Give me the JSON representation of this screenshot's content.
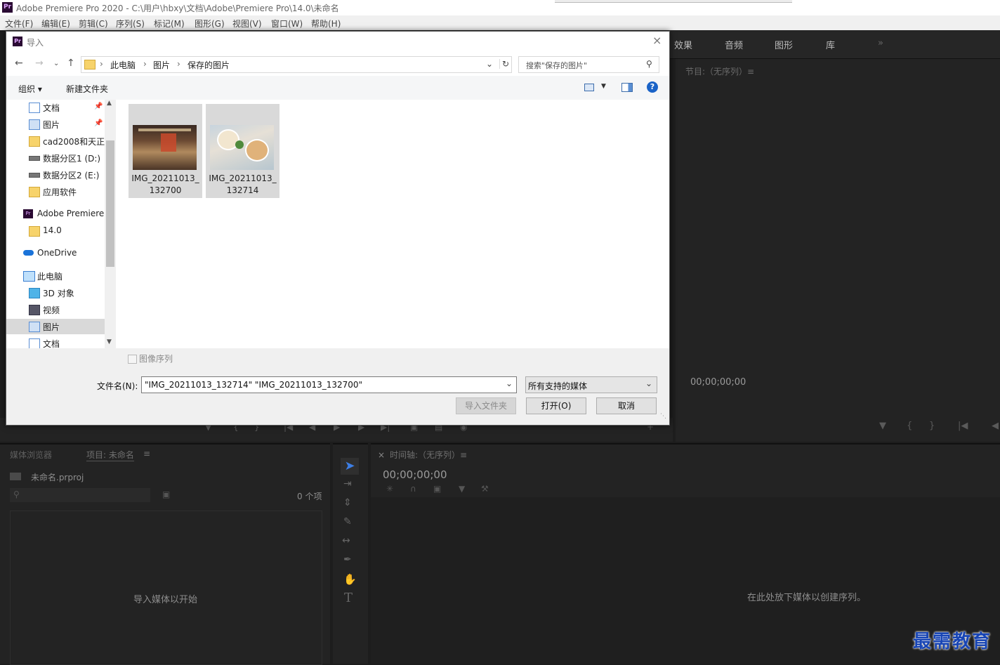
{
  "app": {
    "logo": "Pr",
    "title": "Adobe Premiere Pro 2020 - C:\\用户\\hbxy\\文档\\Adobe\\Premiere Pro\\14.0\\未命名"
  },
  "menu": [
    "文件(F)",
    "编辑(E)",
    "剪辑(C)",
    "序列(S)",
    "标记(M)",
    "图形(G)",
    "视图(V)",
    "窗口(W)",
    "帮助(H)"
  ],
  "workspace_tabs": [
    "效果",
    "音频",
    "图形",
    "库",
    "»"
  ],
  "program_monitor": {
    "title": "节目:（无序列）≡",
    "timecode": "00;00;00;00"
  },
  "project_panel": {
    "tab_media_browser": "媒体浏览器",
    "tab_project": "项目: 未命名",
    "menu_glyph": "≡",
    "project_file": "未命名.prproj",
    "item_count": "0 个项",
    "empty_hint": "导入媒体以开始"
  },
  "timeline": {
    "close": "×",
    "title": "时间轴:（无序列）≡",
    "timecode": "00;00;00;00",
    "empty_hint": "在此处放下媒体以创建序列。"
  },
  "dialog": {
    "title": "导入",
    "close": "×",
    "breadcrumb": [
      "此电脑",
      "图片",
      "保存的图片"
    ],
    "search_placeholder": "搜索\"保存的图片\"",
    "organize": "组织 ▾",
    "new_folder": "新建文件夹",
    "help": "?",
    "nav_items": [
      {
        "label": "文档",
        "icon": "document-icon",
        "pinned": true
      },
      {
        "label": "图片",
        "icon": "pictures-icon",
        "pinned": true
      },
      {
        "label": "cad2008和天正",
        "icon": "folder-icon"
      },
      {
        "label": "数据分区1 (D:)",
        "icon": "drive-icon"
      },
      {
        "label": "数据分区2 (E:)",
        "icon": "drive-icon"
      },
      {
        "label": "应用软件",
        "icon": "folder-icon"
      },
      {
        "label": "Adobe Premiere",
        "icon": "premiere-icon"
      },
      {
        "label": "14.0",
        "icon": "folder-icon"
      },
      {
        "label": "OneDrive",
        "icon": "onedrive-icon"
      },
      {
        "label": "此电脑",
        "icon": "computer-icon"
      },
      {
        "label": "3D 对象",
        "icon": "3d-objects-icon"
      },
      {
        "label": "视频",
        "icon": "video-icon"
      },
      {
        "label": "图片",
        "icon": "pictures-icon",
        "selected": true
      },
      {
        "label": "文档",
        "icon": "document-icon"
      }
    ],
    "files": [
      {
        "line1": "IMG_20211013_",
        "line2": "132700"
      },
      {
        "line1": "IMG_20211013_",
        "line2": "132714"
      }
    ],
    "image_sequence_label": "图像序列",
    "filename_label": "文件名(N):",
    "filename_value": "\"IMG_20211013_132714\" \"IMG_20211013_132700\"",
    "filetype_value": "所有支持的媒体",
    "import_folder_button": "导入文件夹",
    "open_button": "打开(O)",
    "cancel_button": "取消"
  },
  "watermark": "最需教育"
}
